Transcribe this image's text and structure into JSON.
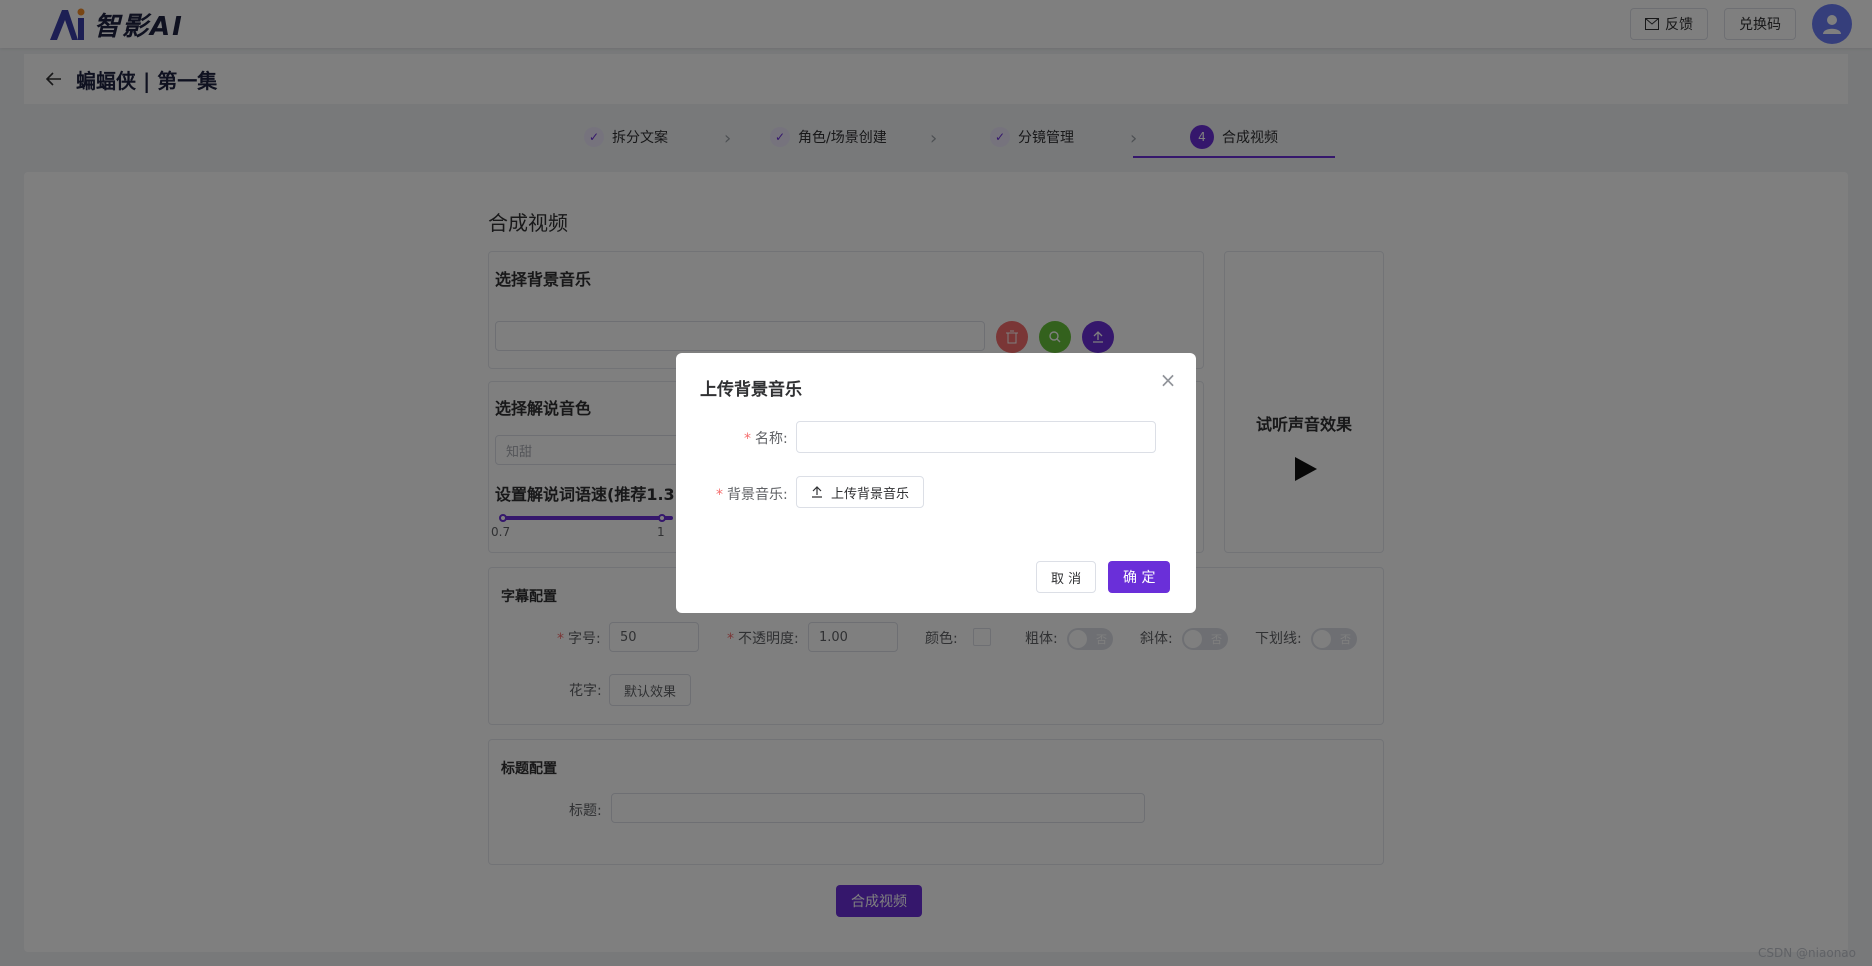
{
  "header": {
    "logo_text": "智影AI",
    "feedback_label": "反馈",
    "redeem_label": "兑换码"
  },
  "titlebar": {
    "title": "蝙蝠侠 | 第一集"
  },
  "steps": [
    {
      "label": "拆分文案",
      "status": "done"
    },
    {
      "label": "角色/场景创建",
      "status": "done"
    },
    {
      "label": "分镜管理",
      "status": "done"
    },
    {
      "label": "合成视频",
      "status": "active",
      "number": "4"
    }
  ],
  "main": {
    "section_title": "合成视频",
    "bgm": {
      "title": "选择背景音乐"
    },
    "voice": {
      "title": "选择解说音色",
      "placeholder": "知甜",
      "speed_title": "设置解说词语速(推荐1.3倍",
      "slider_min_label": "0.7",
      "slider_mid_label": "1"
    },
    "preview": {
      "title": "试听声音效果"
    },
    "subtitle": {
      "title": "字幕配置",
      "font_size_label": "字号:",
      "font_size_value": "50",
      "opacity_label": "不透明度:",
      "opacity_value": "1.00",
      "color_label": "颜色:",
      "bold_label": "粗体:",
      "italic_label": "斜体:",
      "underline_label": "下划线:",
      "switch_off_text": "否",
      "fancy_label": "花字:",
      "fancy_button": "默认效果"
    },
    "heading": {
      "title": "标题配置",
      "title_label": "标题:"
    },
    "compose_button": "合成视频"
  },
  "dialog": {
    "title": "上传背景音乐",
    "name_label": "名称:",
    "bgm_label": "背景音乐:",
    "upload_button": "上传背景音乐",
    "cancel_button": "取 消",
    "confirm_button": "确 定"
  },
  "watermark": "CSDN @niaonao",
  "colors": {
    "primary": "#6a2fd9",
    "danger": "#f56c6c",
    "success": "#67c23a"
  }
}
